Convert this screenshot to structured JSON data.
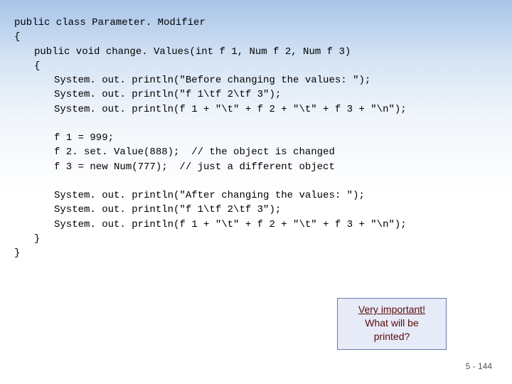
{
  "code": {
    "l1": "public class Parameter. Modifier",
    "l2": "{",
    "l3": "public void change. Values(int f 1, Num f 2, Num f 3)",
    "l4": "{",
    "l5": "System. out. println(\"Before changing the values: \");",
    "l6": "System. out. println(\"f 1\\tf 2\\tf 3\");",
    "l7": "System. out. println(f 1 + \"\\t\" + f 2 + \"\\t\" + f 3 + \"\\n\");",
    "l8": "f 1 = 999;",
    "l9": "f 2. set. Value(888);  // the object is changed",
    "l10": "f 3 = new Num(777);  // just a different object",
    "l11": "System. out. println(\"After changing the values: \");",
    "l12": "System. out. println(\"f 1\\tf 2\\tf 3\");",
    "l13": "System. out. println(f 1 + \"\\t\" + f 2 + \"\\t\" + f 3 + \"\\n\");",
    "l14": "}",
    "l15": "}"
  },
  "callout": {
    "line1": "Very important!",
    "line2": "What will be",
    "line3": "printed?"
  },
  "page_number": "5 - 144"
}
